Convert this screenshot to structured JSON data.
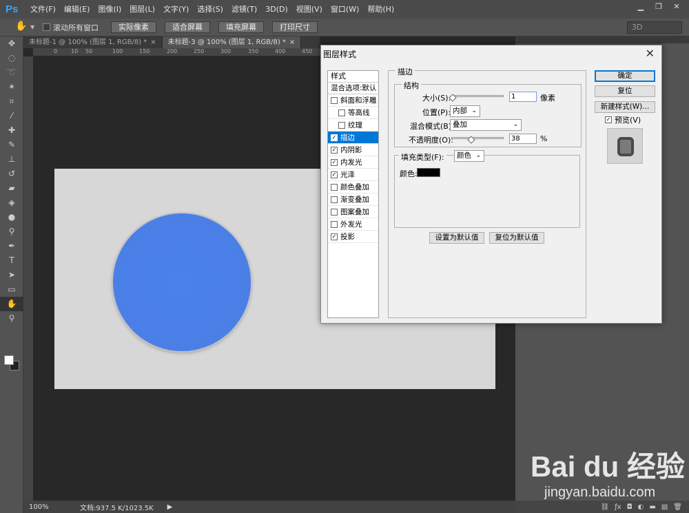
{
  "app": {
    "logo": "Ps",
    "menu": [
      "文件(F)",
      "编辑(E)",
      "图像(I)",
      "图层(L)",
      "文字(Y)",
      "选择(S)",
      "滤镜(T)",
      "3D(D)",
      "视图(V)",
      "窗口(W)",
      "帮助(H)"
    ],
    "window_buttons": [
      "▁",
      "❐",
      "✕"
    ]
  },
  "options_bar": {
    "scroll_all_label": "滚动所有窗口",
    "buttons": [
      "实际像素",
      "适合屏幕",
      "填充屏幕",
      "打印尺寸"
    ],
    "workspace": "3D"
  },
  "tabs": [
    {
      "label": "未标题-1 @ 100% (图层 1, RGB/8) *",
      "active": false
    },
    {
      "label": "未标题-3 @ 100% (图层 1, RGB/8) *",
      "active": true
    }
  ],
  "ruler": {
    "h_ticks": [
      "0",
      "10",
      "50",
      "100",
      "150",
      "200",
      "250",
      "300",
      "350",
      "400",
      "450"
    ]
  },
  "status": {
    "zoom": "100%",
    "doc": "文档:937.5 K/1023.5K"
  },
  "dialog": {
    "title": "图层样式",
    "styles_header": "样式",
    "blend_options": "混合选项:默认",
    "styles": [
      {
        "label": "斜面和浮雕",
        "checked": false,
        "indent": false,
        "selected": false
      },
      {
        "label": "等高线",
        "checked": false,
        "indent": true,
        "selected": false
      },
      {
        "label": "纹理",
        "checked": false,
        "indent": true,
        "selected": false
      },
      {
        "label": "描边",
        "checked": true,
        "indent": false,
        "selected": true
      },
      {
        "label": "内阴影",
        "checked": true,
        "indent": false,
        "selected": false
      },
      {
        "label": "内发光",
        "checked": true,
        "indent": false,
        "selected": false
      },
      {
        "label": "光泽",
        "checked": true,
        "indent": false,
        "selected": false
      },
      {
        "label": "颜色叠加",
        "checked": false,
        "indent": false,
        "selected": false
      },
      {
        "label": "渐变叠加",
        "checked": false,
        "indent": false,
        "selected": false
      },
      {
        "label": "图案叠加",
        "checked": false,
        "indent": false,
        "selected": false
      },
      {
        "label": "外发光",
        "checked": false,
        "indent": false,
        "selected": false
      },
      {
        "label": "投影",
        "checked": true,
        "indent": false,
        "selected": false
      }
    ],
    "stroke": {
      "group_title": "描边",
      "structure_title": "结构",
      "size_label": "大小(S):",
      "size_value": "1",
      "size_unit": "像素",
      "size_level": 0.01,
      "position_label": "位置(P):",
      "position_value": "内部",
      "blend_label": "混合模式(B):",
      "blend_value": "叠加",
      "opacity_label": "不透明度(O):",
      "opacity_value": "38",
      "opacity_unit": "%",
      "fill_type_label": "填充类型(F):",
      "fill_type_value": "颜色",
      "color_label": "颜色:",
      "color_value": "#000000",
      "set_default": "设置为默认值",
      "reset_default": "复位为默认值"
    },
    "buttons": {
      "ok": "确定",
      "reset": "复位",
      "new_style": "新建样式(W)...",
      "preview": "预览(V)"
    }
  },
  "watermark": {
    "brand": "Bai du 经验",
    "url": "jingyan.baidu.com"
  },
  "colors": {
    "circle_blue": "#4a82ea",
    "selection": "#0078d7"
  }
}
